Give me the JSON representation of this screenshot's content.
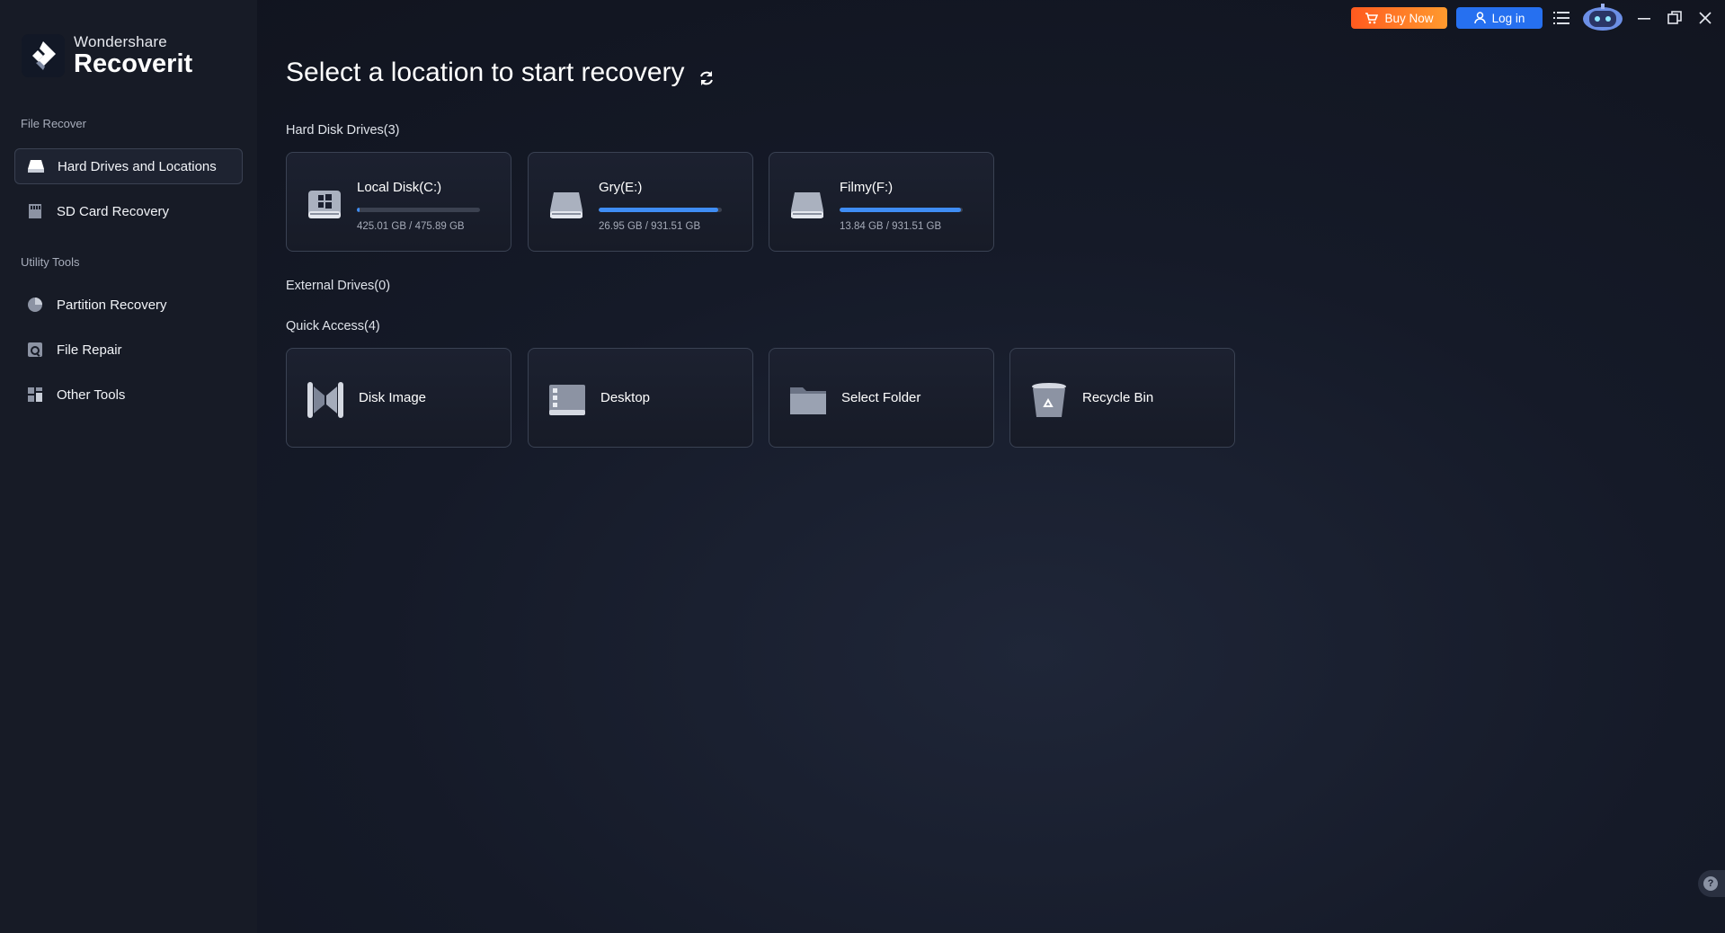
{
  "app": {
    "brand": "Wondershare",
    "product": "Recoverit"
  },
  "sidebar": {
    "sections": [
      {
        "label": "File Recover",
        "items": [
          {
            "label": "Hard Drives and Locations",
            "icon": "hard-drive-icon",
            "active": true
          },
          {
            "label": "SD Card Recovery",
            "icon": "sd-card-icon",
            "active": false
          }
        ]
      },
      {
        "label": "Utility Tools",
        "items": [
          {
            "label": "Partition Recovery",
            "icon": "pie-chart-icon",
            "active": false
          },
          {
            "label": "File Repair",
            "icon": "file-repair-icon",
            "active": false
          },
          {
            "label": "Other Tools",
            "icon": "grid-tools-icon",
            "active": false
          }
        ]
      }
    ]
  },
  "main": {
    "title": "Select a location to start recovery",
    "hard_disk_label": "Hard Disk Drives(3)",
    "drives": [
      {
        "name": "Local Disk(C:)",
        "size": "425.01 GB / 475.89 GB",
        "used_fraction": 0.02,
        "icon": "windows-drive-icon"
      },
      {
        "name": "Gry(E:)",
        "size": "26.95 GB / 931.51 GB",
        "used_fraction": 0.97,
        "icon": "hard-drive-icon"
      },
      {
        "name": "Filmy(F:)",
        "size": "13.84 GB / 931.51 GB",
        "used_fraction": 0.985,
        "icon": "hard-drive-icon"
      }
    ],
    "external_label": "External Drives(0)",
    "quick_access_label": "Quick Access(4)",
    "quick_access": [
      {
        "label": "Disk Image",
        "icon": "disk-image-icon"
      },
      {
        "label": "Desktop",
        "icon": "desktop-icon"
      },
      {
        "label": "Select Folder",
        "icon": "folder-icon"
      },
      {
        "label": "Recycle Bin",
        "icon": "recycle-bin-icon"
      }
    ]
  },
  "topbar": {
    "buy_label": "Buy Now",
    "login_label": "Log in"
  },
  "colors": {
    "accent": "#3f8df4",
    "buy_start": "#ff5a1f",
    "buy_end": "#ff9a2e",
    "login": "#2670f0"
  }
}
